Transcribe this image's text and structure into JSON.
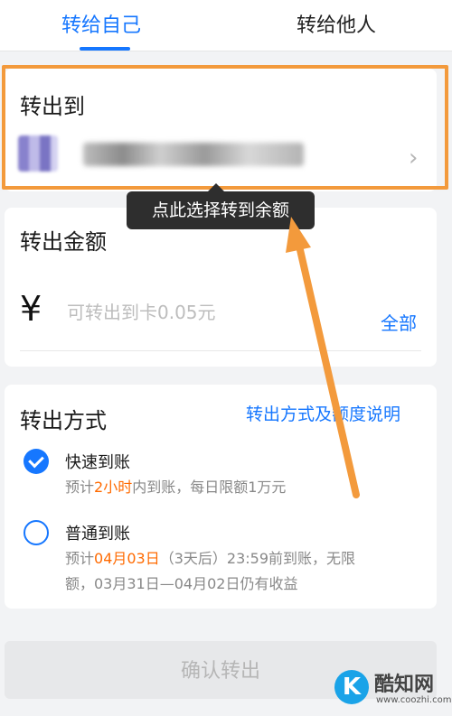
{
  "tabs": {
    "self": "转给自己",
    "others": "转给他人"
  },
  "destination": {
    "title": "转出到",
    "chevron": "›"
  },
  "tooltip": "点此选择转到余额",
  "amount": {
    "title": "转出金额",
    "currency": "¥",
    "placeholder": "可转出到卡0.05元",
    "all_label": "全部"
  },
  "method": {
    "title": "转出方式",
    "explain_link": "转出方式及额度说明",
    "fast": {
      "title": "快速到账",
      "desc_prefix": "预计",
      "desc_highlight": "2小时",
      "desc_suffix": "内到账，每日限额1万元"
    },
    "normal": {
      "title": "普通到账",
      "desc_prefix": "预计",
      "desc_highlight": "04月03日",
      "desc_line1_suffix": "（3天后）23:59前到账，无限",
      "desc_line2": "额，03月31日—04月02日仍有收益"
    }
  },
  "confirm_label": "确认转出",
  "watermark": {
    "logo_letter": "K",
    "name": "酷知网",
    "url": "www.coozhi.com"
  },
  "colors": {
    "accent": "#1677ff",
    "highlight": "#f39a3c",
    "emphasis": "#ff6a00"
  }
}
